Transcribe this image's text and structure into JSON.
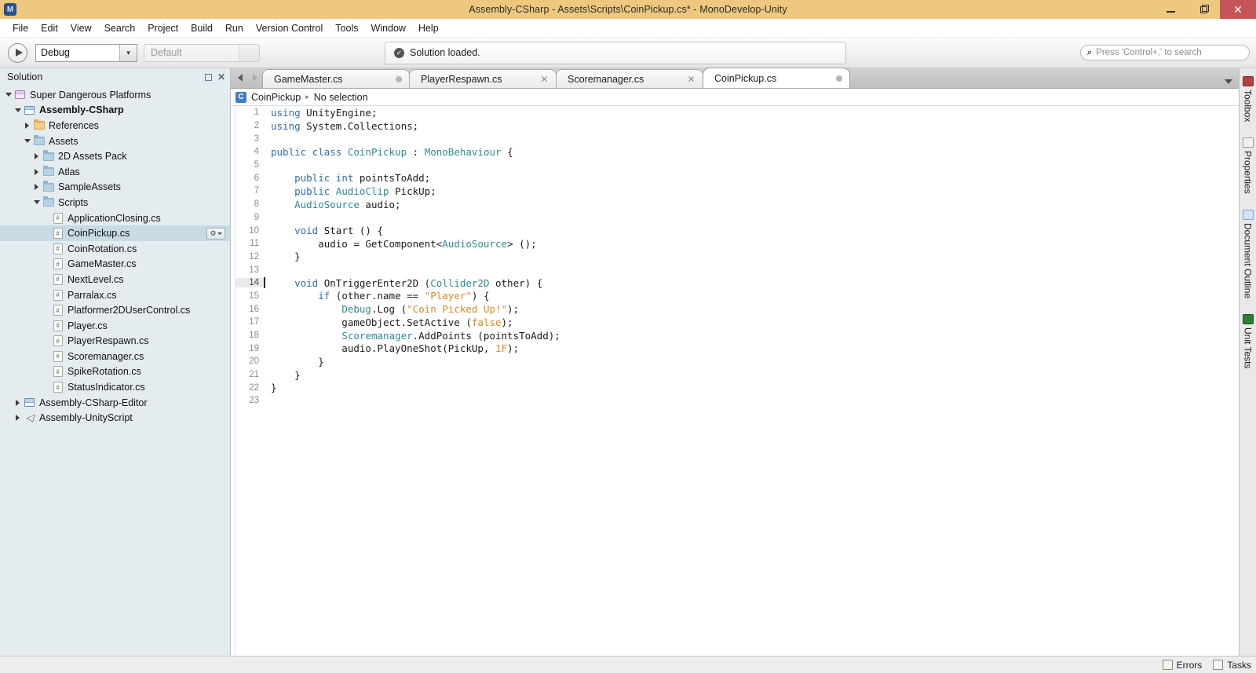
{
  "window": {
    "title": "Assembly-CSharp - Assets\\Scripts\\CoinPickup.cs* - MonoDevelop-Unity",
    "app_icon": "monodevelop-icon",
    "minimize_label": "–",
    "maximize_label": "❐",
    "close_label": "✕"
  },
  "menu": {
    "items": [
      {
        "label": "File"
      },
      {
        "label": "Edit"
      },
      {
        "label": "View"
      },
      {
        "label": "Search"
      },
      {
        "label": "Project"
      },
      {
        "label": "Build"
      },
      {
        "label": "Run"
      },
      {
        "label": "Version Control"
      },
      {
        "label": "Tools"
      },
      {
        "label": "Window"
      },
      {
        "label": "Help"
      }
    ]
  },
  "toolbar": {
    "run_label": "▶",
    "configuration": {
      "value": "Debug",
      "arrow": "▾"
    },
    "runtime": {
      "placeholder": "Default"
    },
    "status": {
      "icon": "✓",
      "text": "Solution loaded."
    },
    "search": {
      "icon": "⌕",
      "placeholder": "Press 'Control+,' to search"
    }
  },
  "solution_pad": {
    "title": "Solution",
    "minimize_label": "",
    "close_label": "✕",
    "gear_label": "⚙",
    "tree": [
      {
        "label": "Super Dangerous Platforms",
        "indent": 0,
        "expander": "down",
        "icon": "solution",
        "bold": false,
        "selected": false,
        "gear": false
      },
      {
        "label": "Assembly-CSharp",
        "indent": 1,
        "expander": "down",
        "icon": "project",
        "bold": true,
        "selected": false,
        "gear": false
      },
      {
        "label": "References",
        "indent": 2,
        "expander": "right",
        "icon": "folder-refs",
        "bold": false,
        "selected": false,
        "gear": false
      },
      {
        "label": "Assets",
        "indent": 2,
        "expander": "down",
        "icon": "folder",
        "bold": false,
        "selected": false,
        "gear": false
      },
      {
        "label": "2D Assets Pack",
        "indent": 3,
        "expander": "right",
        "icon": "folder",
        "bold": false,
        "selected": false,
        "gear": false
      },
      {
        "label": "Atlas",
        "indent": 3,
        "expander": "right",
        "icon": "folder",
        "bold": false,
        "selected": false,
        "gear": false
      },
      {
        "label": "SampleAssets",
        "indent": 3,
        "expander": "right",
        "icon": "folder",
        "bold": false,
        "selected": false,
        "gear": false
      },
      {
        "label": "Scripts",
        "indent": 3,
        "expander": "down",
        "icon": "folder",
        "bold": false,
        "selected": false,
        "gear": false
      },
      {
        "label": "ApplicationClosing.cs",
        "indent": 4,
        "expander": "none",
        "icon": "csharp-file",
        "bold": false,
        "selected": false,
        "gear": false
      },
      {
        "label": "CoinPickup.cs",
        "indent": 4,
        "expander": "none",
        "icon": "csharp-file",
        "bold": false,
        "selected": true,
        "gear": true
      },
      {
        "label": "CoinRotation.cs",
        "indent": 4,
        "expander": "none",
        "icon": "csharp-file",
        "bold": false,
        "selected": false,
        "gear": false
      },
      {
        "label": "GameMaster.cs",
        "indent": 4,
        "expander": "none",
        "icon": "csharp-file",
        "bold": false,
        "selected": false,
        "gear": false
      },
      {
        "label": "NextLevel.cs",
        "indent": 4,
        "expander": "none",
        "icon": "csharp-file",
        "bold": false,
        "selected": false,
        "gear": false
      },
      {
        "label": "Parralax.cs",
        "indent": 4,
        "expander": "none",
        "icon": "csharp-file",
        "bold": false,
        "selected": false,
        "gear": false
      },
      {
        "label": "Platformer2DUserControl.cs",
        "indent": 4,
        "expander": "none",
        "icon": "csharp-file",
        "bold": false,
        "selected": false,
        "gear": false
      },
      {
        "label": "Player.cs",
        "indent": 4,
        "expander": "none",
        "icon": "csharp-file",
        "bold": false,
        "selected": false,
        "gear": false
      },
      {
        "label": "PlayerRespawn.cs",
        "indent": 4,
        "expander": "none",
        "icon": "csharp-file",
        "bold": false,
        "selected": false,
        "gear": false
      },
      {
        "label": "Scoremanager.cs",
        "indent": 4,
        "expander": "none",
        "icon": "csharp-file",
        "bold": false,
        "selected": false,
        "gear": false
      },
      {
        "label": "SpikeRotation.cs",
        "indent": 4,
        "expander": "none",
        "icon": "csharp-file",
        "bold": false,
        "selected": false,
        "gear": false
      },
      {
        "label": "StatusIndicator.cs",
        "indent": 4,
        "expander": "none",
        "icon": "csharp-file",
        "bold": false,
        "selected": false,
        "gear": false
      },
      {
        "label": "Assembly-CSharp-Editor",
        "indent": 1,
        "expander": "right",
        "icon": "project",
        "bold": false,
        "selected": false,
        "gear": false
      },
      {
        "label": "Assembly-UnityScript",
        "indent": 1,
        "expander": "right",
        "icon": "unity",
        "bold": false,
        "selected": false,
        "gear": false
      }
    ]
  },
  "editor": {
    "nav_back": "◀",
    "nav_forward": "▶",
    "overflow_label": "▾",
    "tabs": [
      {
        "label": "GameMaster.cs",
        "active": false,
        "modified": true,
        "close_label": "●"
      },
      {
        "label": "PlayerRespawn.cs",
        "active": false,
        "modified": false,
        "close_label": "✕"
      },
      {
        "label": "Scoremanager.cs",
        "active": false,
        "modified": false,
        "close_label": "✕"
      },
      {
        "label": "CoinPickup.cs",
        "active": true,
        "modified": true,
        "close_label": "●"
      }
    ],
    "breadcrumb": {
      "icon_label": "C",
      "class_name": "CoinPickup",
      "separator": "▸",
      "member": "No selection"
    },
    "cursor_line": 14,
    "lines": [
      {
        "n": 1,
        "tokens": [
          {
            "t": "using",
            "c": "k"
          },
          {
            "t": " UnityEngine;",
            "c": "pl"
          }
        ]
      },
      {
        "n": 2,
        "tokens": [
          {
            "t": "using",
            "c": "k"
          },
          {
            "t": " System.Collections;",
            "c": "pl"
          }
        ]
      },
      {
        "n": 3,
        "tokens": []
      },
      {
        "n": 4,
        "tokens": [
          {
            "t": "public",
            "c": "k"
          },
          {
            "t": " ",
            "c": "pl"
          },
          {
            "t": "class",
            "c": "k"
          },
          {
            "t": " ",
            "c": "pl"
          },
          {
            "t": "CoinPickup",
            "c": "ty"
          },
          {
            "t": " : ",
            "c": "pl"
          },
          {
            "t": "MonoBehaviour",
            "c": "ty"
          },
          {
            "t": " {",
            "c": "pl"
          }
        ]
      },
      {
        "n": 5,
        "tokens": []
      },
      {
        "n": 6,
        "tokens": [
          {
            "t": "    ",
            "c": "pl"
          },
          {
            "t": "public",
            "c": "k"
          },
          {
            "t": " ",
            "c": "pl"
          },
          {
            "t": "int",
            "c": "k"
          },
          {
            "t": " pointsToAdd;",
            "c": "pl"
          }
        ]
      },
      {
        "n": 7,
        "tokens": [
          {
            "t": "    ",
            "c": "pl"
          },
          {
            "t": "public",
            "c": "k"
          },
          {
            "t": " ",
            "c": "pl"
          },
          {
            "t": "AudioClip",
            "c": "ty"
          },
          {
            "t": " PickUp;",
            "c": "pl"
          }
        ]
      },
      {
        "n": 8,
        "tokens": [
          {
            "t": "    ",
            "c": "pl"
          },
          {
            "t": "AudioSource",
            "c": "ty"
          },
          {
            "t": " audio;",
            "c": "pl"
          }
        ]
      },
      {
        "n": 9,
        "tokens": []
      },
      {
        "n": 10,
        "tokens": [
          {
            "t": "    ",
            "c": "pl"
          },
          {
            "t": "void",
            "c": "k"
          },
          {
            "t": " Start () {",
            "c": "pl"
          }
        ]
      },
      {
        "n": 11,
        "tokens": [
          {
            "t": "        audio = GetComponent<",
            "c": "pl"
          },
          {
            "t": "AudioSource",
            "c": "ty"
          },
          {
            "t": "> ();",
            "c": "pl"
          }
        ]
      },
      {
        "n": 12,
        "tokens": [
          {
            "t": "    }",
            "c": "pl"
          }
        ]
      },
      {
        "n": 13,
        "tokens": []
      },
      {
        "n": 14,
        "tokens": [
          {
            "t": "    ",
            "c": "pl"
          },
          {
            "t": "void",
            "c": "k"
          },
          {
            "t": " OnTriggerEnter2D (",
            "c": "pl"
          },
          {
            "t": "Collider2D",
            "c": "ty"
          },
          {
            "t": " other) {",
            "c": "pl"
          }
        ]
      },
      {
        "n": 15,
        "tokens": [
          {
            "t": "        ",
            "c": "pl"
          },
          {
            "t": "if",
            "c": "k"
          },
          {
            "t": " (other.name == ",
            "c": "pl"
          },
          {
            "t": "\"Player\"",
            "c": "st"
          },
          {
            "t": ") {",
            "c": "pl"
          }
        ]
      },
      {
        "n": 16,
        "tokens": [
          {
            "t": "            ",
            "c": "pl"
          },
          {
            "t": "Debug",
            "c": "ty"
          },
          {
            "t": ".Log (",
            "c": "pl"
          },
          {
            "t": "\"Coin Picked Up!\"",
            "c": "st"
          },
          {
            "t": ");",
            "c": "pl"
          }
        ]
      },
      {
        "n": 17,
        "tokens": [
          {
            "t": "            gameObject.SetActive (",
            "c": "pl"
          },
          {
            "t": "false",
            "c": "st"
          },
          {
            "t": ");",
            "c": "pl"
          }
        ]
      },
      {
        "n": 18,
        "tokens": [
          {
            "t": "            ",
            "c": "pl"
          },
          {
            "t": "Scoremanager",
            "c": "ty"
          },
          {
            "t": ".AddPoints (pointsToAdd);",
            "c": "pl"
          }
        ]
      },
      {
        "n": 19,
        "tokens": [
          {
            "t": "            audio.PlayOneShot(PickUp, ",
            "c": "pl"
          },
          {
            "t": "1F",
            "c": "nm"
          },
          {
            "t": ");",
            "c": "pl"
          }
        ]
      },
      {
        "n": 20,
        "tokens": [
          {
            "t": "        }",
            "c": "pl"
          }
        ]
      },
      {
        "n": 21,
        "tokens": [
          {
            "t": "    }",
            "c": "pl"
          }
        ]
      },
      {
        "n": 22,
        "tokens": [
          {
            "t": "}",
            "c": "pl"
          }
        ]
      },
      {
        "n": 23,
        "tokens": []
      }
    ]
  },
  "right_dock": {
    "tabs": [
      {
        "label": "Toolbox",
        "icon": "toolbox-icon",
        "style": "toolbox"
      },
      {
        "label": "Properties",
        "icon": "properties-icon",
        "style": "props"
      },
      {
        "label": "Document Outline",
        "icon": "document-outline-icon",
        "style": "outline"
      },
      {
        "label": "Unit Tests",
        "icon": "unit-tests-icon",
        "style": "tests"
      }
    ]
  },
  "statusbar": {
    "errors_label": "Errors",
    "tasks_label": "Tasks"
  }
}
